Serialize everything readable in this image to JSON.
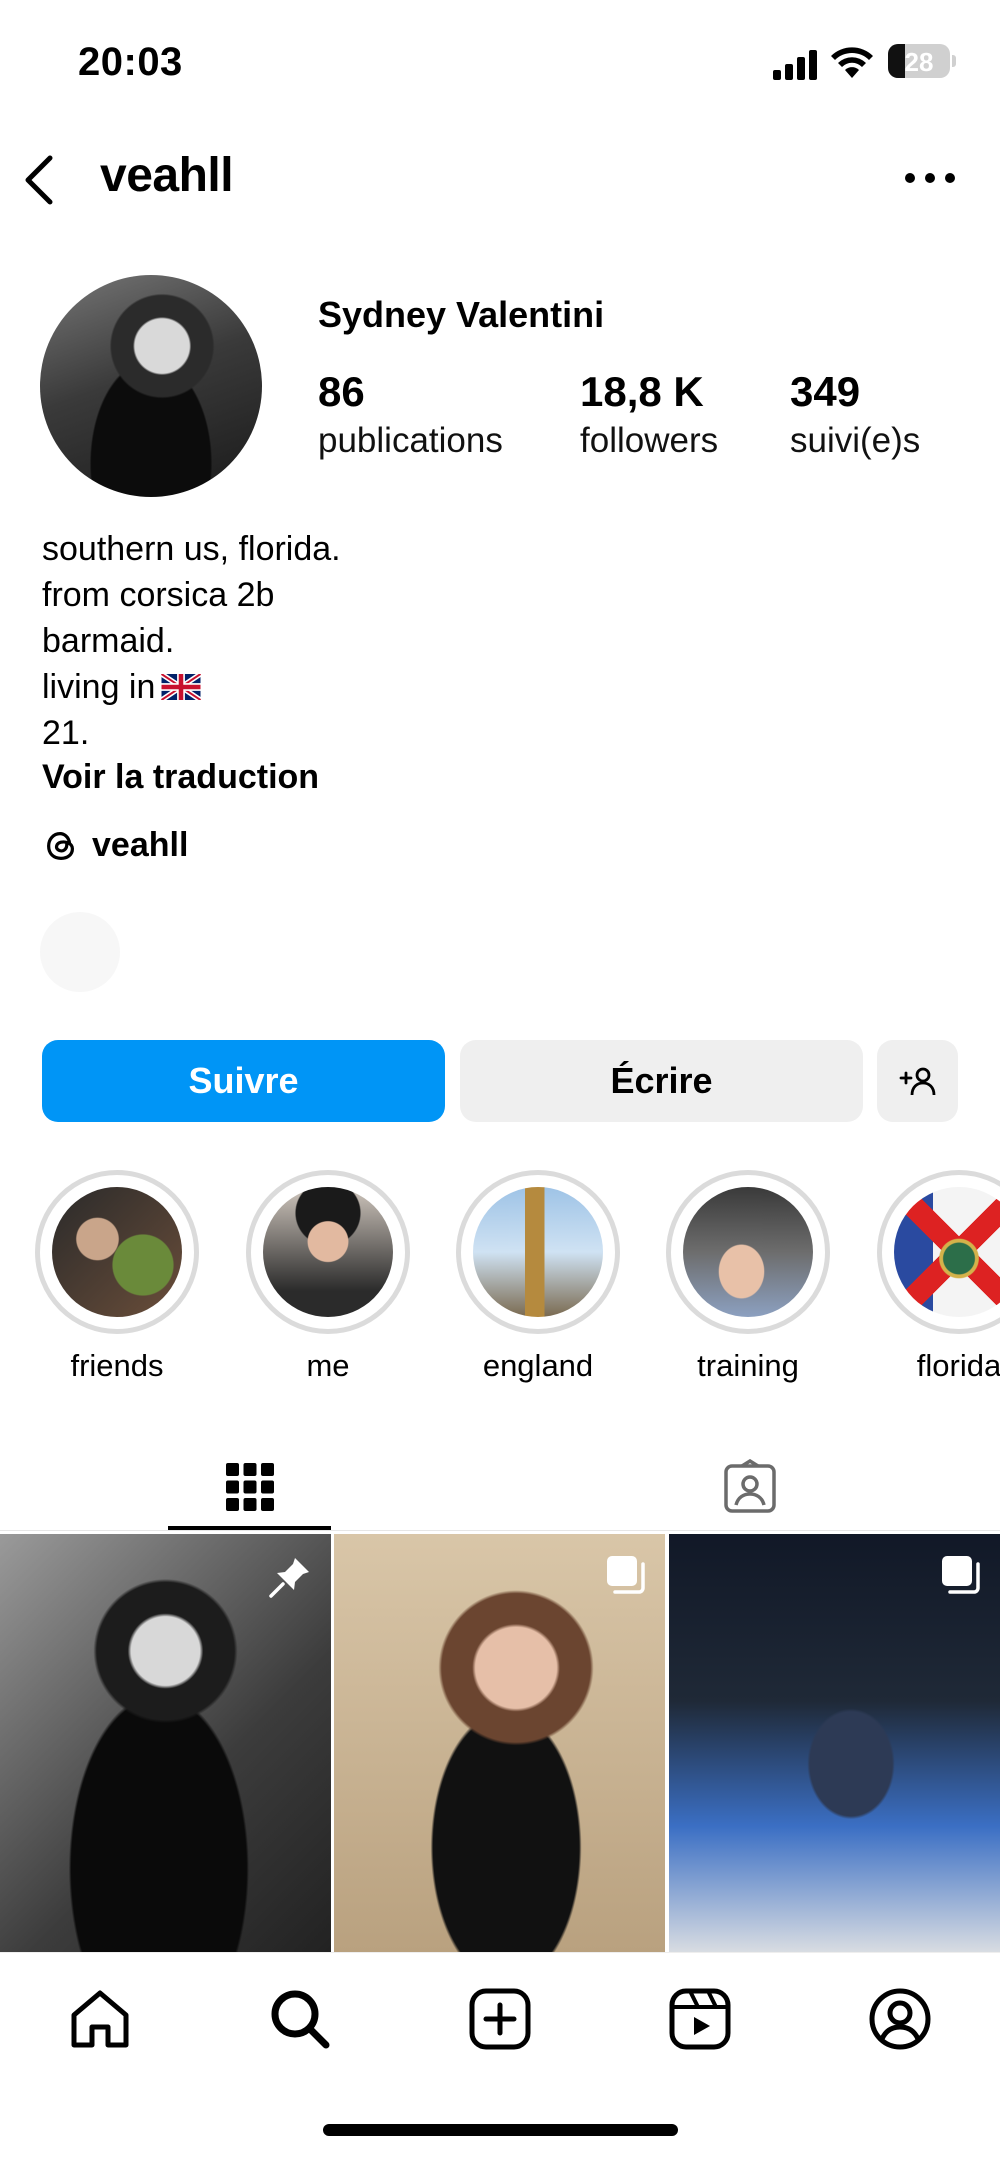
{
  "status_bar": {
    "time": "20:03",
    "battery": "28"
  },
  "header": {
    "username": "veahll"
  },
  "profile": {
    "display_name": "Sydney Valentini",
    "stats": [
      {
        "value": "86",
        "label": "publications"
      },
      {
        "value": "18,8 K",
        "label": "followers"
      },
      {
        "value": "349",
        "label": "suivi(e)s"
      }
    ],
    "bio": [
      "southern us, florida.",
      "from corsica 2b",
      "barmaid.",
      "living in",
      "21."
    ],
    "bio_flag_icon": "uk-flag-icon",
    "translate_label": "Voir la traduction",
    "threads_handle": "veahll"
  },
  "actions": {
    "follow_label": "Suivre",
    "message_label": "Écrire",
    "add_icon": "add-person-icon"
  },
  "highlights": [
    {
      "label": "friends"
    },
    {
      "label": "me"
    },
    {
      "label": "england"
    },
    {
      "label": "training"
    },
    {
      "label": "florida"
    }
  ],
  "tabs": [
    {
      "name": "grid",
      "icon": "grid-icon",
      "active": true
    },
    {
      "name": "tagged",
      "icon": "tagged-icon",
      "active": false
    }
  ],
  "posts": [
    {
      "badge_icon": "pin-icon"
    },
    {
      "badge_icon": "multi-image-icon"
    },
    {
      "badge_icon": "multi-image-icon"
    }
  ],
  "bottom_nav": [
    "home-icon",
    "search-icon",
    "create-icon",
    "reels-icon",
    "profile-icon"
  ],
  "colors": {
    "accent": "#0095f6",
    "button_gray": "#efefef",
    "ring_gray": "#dbdbdb"
  }
}
